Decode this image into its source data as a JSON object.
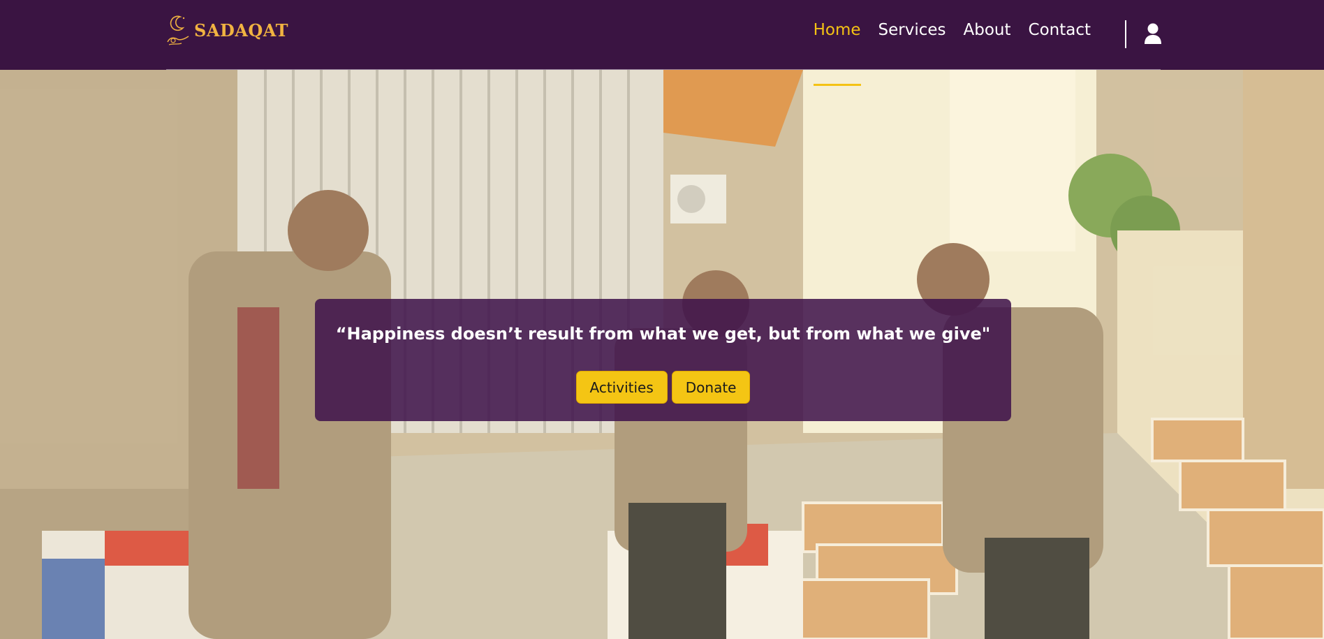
{
  "brand": {
    "name": "SADAQAT",
    "logo_icon": "crescent-hand-logo-icon",
    "color": "#f1b341"
  },
  "nav": {
    "items": [
      {
        "label": "Home",
        "active": true
      },
      {
        "label": "Services",
        "active": false
      },
      {
        "label": "About",
        "active": false
      },
      {
        "label": "Contact",
        "active": false
      }
    ],
    "user_icon": "user-icon",
    "active_color": "#f4c214",
    "background": "#3a1442"
  },
  "hero": {
    "image": "volunteers-packing-aid-boxes",
    "quote": "“Happiness doesn’t result from what we get, but from what we give\"",
    "buttons": {
      "activities": "Activities",
      "donate": "Donate"
    },
    "button_color": "#f4c514"
  }
}
